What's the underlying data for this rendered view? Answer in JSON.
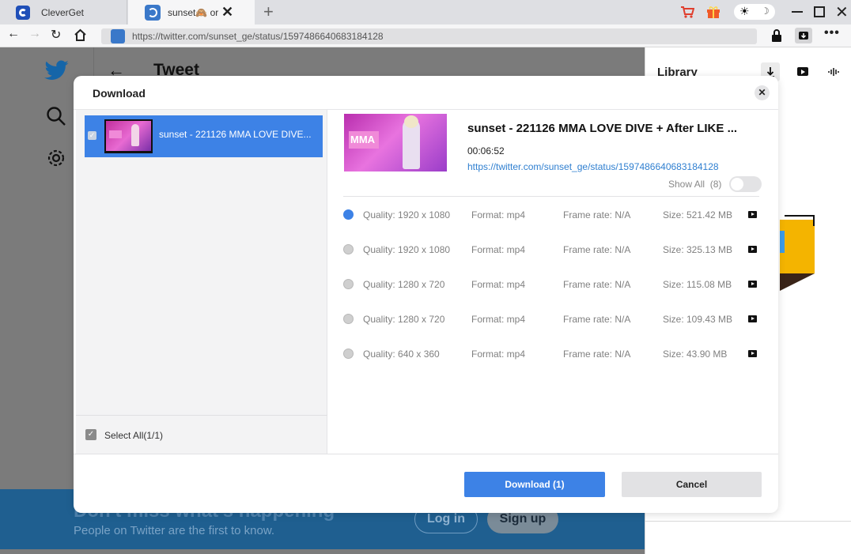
{
  "browser": {
    "tabs": [
      {
        "label": "CleverGet"
      },
      {
        "label": "sunset🙈 or"
      }
    ],
    "url": "https://twitter.com/sunset_ge/status/1597486640683184128"
  },
  "twitter": {
    "header_title": "Tweet",
    "banner_title": "Don't miss what's happening",
    "banner_subtitle": "People on Twitter are the first to know.",
    "login_label": "Log in",
    "signup_label": "Sign up"
  },
  "library": {
    "title": "Library"
  },
  "dialog": {
    "title": "Download",
    "list_item_title": "sunset - 221126 MMA  LOVE DIVE...",
    "select_all_label": "Select All(1/1)",
    "video_title": "sunset - 221126 MMA  LOVE DIVE + After LIKE ...",
    "duration": "00:06:52",
    "video_url": "https://twitter.com/sunset_ge/status/1597486640683184128",
    "show_all_label": "Show All  (8)",
    "options": [
      {
        "quality": "Quality: 1920 x 1080",
        "format": "Format: mp4",
        "frame_rate": "Frame rate: N/A",
        "size": "Size: 521.42 MB",
        "selected": true
      },
      {
        "quality": "Quality: 1920 x 1080",
        "format": "Format: mp4",
        "frame_rate": "Frame rate: N/A",
        "size": "Size: 325.13 MB",
        "selected": false
      },
      {
        "quality": "Quality: 1280 x 720",
        "format": "Format: mp4",
        "frame_rate": "Frame rate: N/A",
        "size": "Size: 115.08 MB",
        "selected": false
      },
      {
        "quality": "Quality: 1280 x 720",
        "format": "Format: mp4",
        "frame_rate": "Frame rate: N/A",
        "size": "Size: 109.43 MB",
        "selected": false
      },
      {
        "quality": "Quality: 640 x 360",
        "format": "Format: mp4",
        "frame_rate": "Frame rate: N/A",
        "size": "Size: 43.90 MB",
        "selected": false
      }
    ],
    "download_label": "Download (1)",
    "cancel_label": "Cancel",
    "thumbnail_text": "MMA"
  },
  "colors": {
    "accent": "#3d82e6",
    "link": "#2f7fd0",
    "list_selected": "#3d82e6",
    "twitter_blue": "#1d9bf0"
  }
}
